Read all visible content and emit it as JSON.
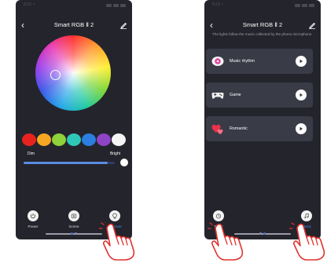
{
  "left_screen": {
    "status_time": "8:23 ✓",
    "title": "Smart RGB Ⅱ 2",
    "back_glyph": "‹",
    "swatches": [
      "#e8231f",
      "#f5a623",
      "#8fd13a",
      "#2ec7b8",
      "#2a7fe0",
      "#8e44c7",
      "#f5f5f5"
    ],
    "dim_label": "Dim",
    "bright_label": "Bright",
    "brightness": 0.92,
    "nav": [
      {
        "label": "Power",
        "icon": "power-icon",
        "active": false
      },
      {
        "label": "Scene",
        "icon": "scene-icon",
        "active": false
      },
      {
        "label": "Discover",
        "icon": "discover-icon",
        "active": true
      }
    ]
  },
  "right_screen": {
    "status_time": "8:23 ✓",
    "title": "Smart RGB Ⅱ 2",
    "back_glyph": "‹",
    "description": "The lights follow the music collected by the phone microphone",
    "modes": [
      {
        "label": "Music rhythm",
        "icon": "music-rhythm-icon"
      },
      {
        "label": "Game",
        "icon": "game-controller-icon"
      },
      {
        "label": "Romantic",
        "icon": "romantic-hearts-icon"
      }
    ],
    "nav": [
      {
        "label": "Timer",
        "icon": "timer-icon",
        "active": false
      },
      {
        "label": "Music",
        "icon": "music-note-icon",
        "active": true
      }
    ]
  },
  "colors": {
    "screen_bg": "#24242c",
    "card_bg": "#393b47",
    "accent": "#3e8cf0",
    "hand_outline": "#e0332f"
  }
}
